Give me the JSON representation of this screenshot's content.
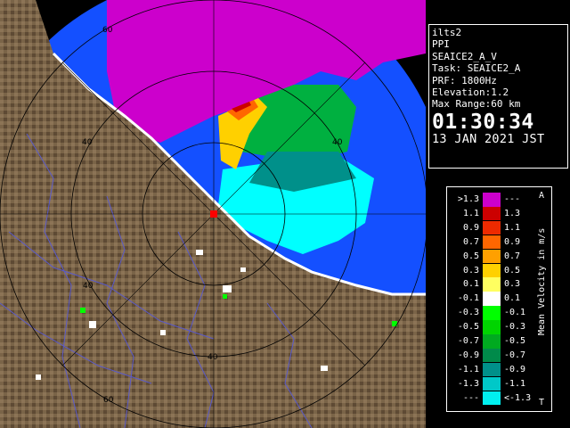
{
  "info": {
    "lines": [
      "ilts2",
      "PPI",
      "SEAICE2_A_V",
      "Task: SEAICE2_A",
      "PRF: 1800Hz",
      "Elevation:1.2",
      "Max Range:60 km"
    ],
    "time": "01:30:34",
    "date": "13 JAN 2021 JST"
  },
  "legend": {
    "unit": "Mean Velocity in m/s",
    "top_mark": "A",
    "bottom_mark": "T",
    "rows": [
      {
        "lo": ">1.3",
        "hi": "---",
        "color": "#cc00cc"
      },
      {
        "lo": "1.1",
        "hi": "1.3",
        "color": "#cc0000"
      },
      {
        "lo": "0.9",
        "hi": "1.1",
        "color": "#ee2a00"
      },
      {
        "lo": "0.7",
        "hi": "0.9",
        "color": "#ff6600"
      },
      {
        "lo": "0.5",
        "hi": "0.7",
        "color": "#ffa000"
      },
      {
        "lo": "0.3",
        "hi": "0.5",
        "color": "#ffd000"
      },
      {
        "lo": "0.1",
        "hi": "0.3",
        "color": "#ffff60"
      },
      {
        "lo": "-0.1",
        "hi": "0.1",
        "color": "#ffffff"
      },
      {
        "lo": "-0.3",
        "hi": "-0.1",
        "color": "#00ff00"
      },
      {
        "lo": "-0.5",
        "hi": "-0.3",
        "color": "#00d400"
      },
      {
        "lo": "-0.7",
        "hi": "-0.5",
        "color": "#00aa20"
      },
      {
        "lo": "-0.9",
        "hi": "-0.7",
        "color": "#008a4a"
      },
      {
        "lo": "-1.1",
        "hi": "-0.9",
        "color": "#00908a"
      },
      {
        "lo": "-1.3",
        "hi": "-1.1",
        "color": "#00c8c8"
      },
      {
        "lo": "---",
        "hi": "<-1.3",
        "color": "#00f0f0"
      }
    ]
  },
  "map": {
    "ring_labels": [
      "60",
      "40",
      "40",
      "40",
      "40",
      "60"
    ],
    "colors": {
      "sea": "#1450ff",
      "land": "#7a6448",
      "purple": "#cc00cc",
      "cyan": "#00ffff"
    }
  }
}
